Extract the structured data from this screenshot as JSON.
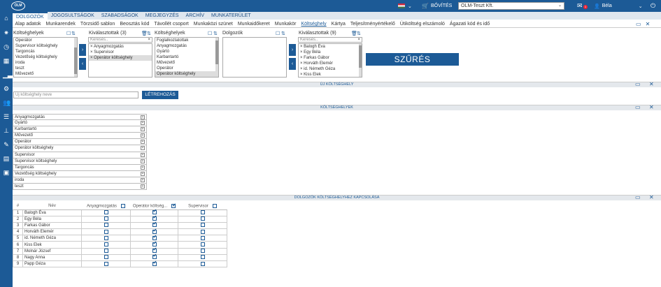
{
  "app": {
    "logo": "OLM",
    "add_button": "BŐVÍTÉS",
    "company": "OLM-Teszt Kft.",
    "notification_count": "1",
    "user": "Béla",
    "main_tabs": [
      "DOLGOZÓK",
      "JOGOSULTSÁGOK",
      "SZABADSÁGOK",
      "MEGJEGYZÉS",
      "ARCHÍV",
      "MUNKATERÜLET"
    ],
    "sub_tabs": [
      "Alap adatok",
      "Munkarendek",
      "Törzsidő sablon",
      "Beosztás kód",
      "Távollét csoport",
      "Munkaközi szünet",
      "Munkaidőkeret",
      "Munkakör",
      "Költséghely",
      "Kártya",
      "Teljesítményértékelő",
      "Útiköltség elszámoló",
      "Ágazati kód és idő"
    ]
  },
  "filter": {
    "cost_centers_header": "Költséghelyek",
    "cost_centers_list": [
      "Operátor",
      "Supervisor költséghely",
      "Targoncás",
      "Vezetőség költséghely",
      "iroda",
      "teszt",
      "Művezető",
      "Karbantartó"
    ],
    "selected_header": "Kiválasztottak (3)",
    "search_placeholder": "Keresés..",
    "selected_list": [
      "Anyagmozgatás",
      "Supervisor",
      "Operátor költséghely"
    ],
    "cost_centers2_header": "Költséghelyek",
    "cost_centers2_list": [
      "Foglalkoztatottak",
      "Anyagmozgatás",
      "Gyártó",
      "Karbantartó",
      "Művezető",
      "Operátor",
      "Operátor költséghely"
    ],
    "workers_header": "Dolgozók",
    "selected2_header": "Kiválasztottak (9)",
    "selected2_list": [
      "Balogh Éva",
      "Egy Béla",
      "Farkas Gábor",
      "Horváth Elemér",
      "id. Németh Géza",
      "Kiss Elek"
    ],
    "filter_button": "SZŰRÉS"
  },
  "new_cost_center": {
    "section_title": "ÚJ KÖLTSÉGHELY",
    "name_placeholder": "Új költséghely neve",
    "create_button": "LÉTREHOZÁS"
  },
  "cost_centers": {
    "section_title": "KÖLTSÉGHELYEK",
    "items": [
      "Anyagmozgatás",
      "Gyártó",
      "Karbantartó",
      "Művezető",
      "Operátor",
      "Operátor költséghely",
      "Supervisor",
      "Supervisor költséghely",
      "Targoncás",
      "Vezetőség költséghely",
      "iroda",
      "teszt"
    ]
  },
  "assignment": {
    "section_title": "DOLGOZÓK KÖLTSÉGHELYHEZ KAPCSOLÁSA",
    "col_index": "#",
    "col_name": "Név",
    "cols": [
      "Anyagmozgatás",
      "Operátor költség...",
      "Supervisor"
    ],
    "col_checked": [
      false,
      true,
      false
    ],
    "rows": [
      {
        "n": "1",
        "name": "Balogh Éva",
        "v": [
          false,
          true,
          false
        ]
      },
      {
        "n": "2",
        "name": "Egy Béla",
        "v": [
          false,
          true,
          false
        ]
      },
      {
        "n": "3",
        "name": "Farkas Gábor",
        "v": [
          false,
          true,
          false
        ]
      },
      {
        "n": "4",
        "name": "Horváth Elemér",
        "v": [
          false,
          true,
          false
        ]
      },
      {
        "n": "5",
        "name": "id. Németh Géza",
        "v": [
          false,
          true,
          false
        ]
      },
      {
        "n": "6",
        "name": "Kiss Elek",
        "v": [
          false,
          true,
          false
        ]
      },
      {
        "n": "7",
        "name": "Molnár József",
        "v": [
          false,
          true,
          false
        ]
      },
      {
        "n": "8",
        "name": "Nagy Anna",
        "v": [
          false,
          true,
          false
        ]
      },
      {
        "n": "9",
        "name": "Papp Géza",
        "v": [
          false,
          true,
          false
        ]
      }
    ]
  },
  "colors": {
    "brand": "#1c5a96",
    "filter_button": "#1c5a96"
  },
  "icons": [
    "home-icon",
    "settings-icon",
    "clock-icon",
    "calendar-icon",
    "chart-icon",
    "gears-icon",
    "users-icon",
    "list-icon",
    "stamp-icon",
    "edit-icon",
    "inbox-icon",
    "archive-icon"
  ]
}
